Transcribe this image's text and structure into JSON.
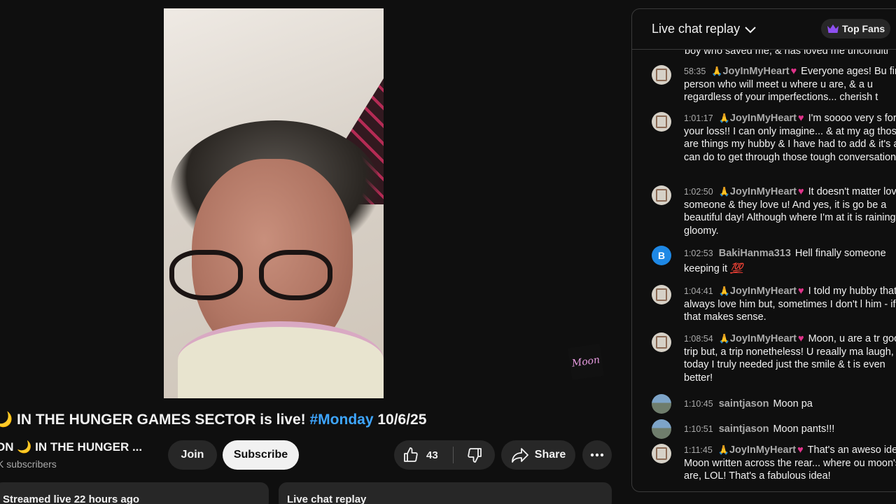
{
  "video": {
    "title_prefix": "🌙 IN THE HUNGER GAMES SECTOR is live! ",
    "title_hashtag": "#Monday",
    "title_suffix": " 10/6/25",
    "watermark": "Moon"
  },
  "channel": {
    "name": "ON 🌙 IN THE HUNGER ...",
    "subscribers": "K subscribers"
  },
  "actions": {
    "join": "Join",
    "subscribe": "Subscribe",
    "likes": "43",
    "share": "Share"
  },
  "cards": {
    "streamed": "Streamed live 22 hours ago",
    "chat_replay": "Live chat replay"
  },
  "chat": {
    "title": "Live chat replay",
    "top_fans": "Top Fans",
    "cut_line": "boy who saved me, & has loved me unconditi",
    "messages": [
      {
        "time": "58:35",
        "author": "JoyInMyHeart",
        "text": "Everyone ages! Bu find a person who will meet u where u are, & a u regardless of your imperfections... cherish t"
      },
      {
        "time": "1:01:17",
        "author": "JoyInMyHeart",
        "text": "I'm soooo very s for your loss!! I can only imagine... & at my ag those are things my hubby & I have had to add & it's all I can do to get through those tough conversations!"
      },
      {
        "time": "1:02:50",
        "author": "JoyInMyHeart",
        "text": "It doesn't matter loved someone & they love u! And yes, it is go be a beautiful day! Although where I'm at it is raining & gloomy."
      },
      {
        "time": "1:02:53",
        "author": "BakiHanma313",
        "text": "Hell finally someone keeping it",
        "emoji": "💯",
        "avatar_letter": "B"
      },
      {
        "time": "1:04:41",
        "author": "JoyInMyHeart",
        "text": "I told my hubby that I always love him but, sometimes I don't l him - if that makes sense."
      },
      {
        "time": "1:08:54",
        "author": "JoyInMyHeart",
        "text": "Moon, u are a tr good trip but, a trip nonetheless! U reaally ma laugh, & today I truly needed just the smile & t is even better!"
      },
      {
        "time": "1:10:45",
        "author": "saintjason",
        "text": "Moon pa"
      },
      {
        "time": "1:10:51",
        "author": "saintjason",
        "text": "Moon pants!!!"
      },
      {
        "time": "1:11:45",
        "author": "JoyInMyHeart",
        "text": "That's an aweso idea! Moon written across the rear... where ou moon's are, LOL! That's a fabulous idea!"
      }
    ]
  }
}
